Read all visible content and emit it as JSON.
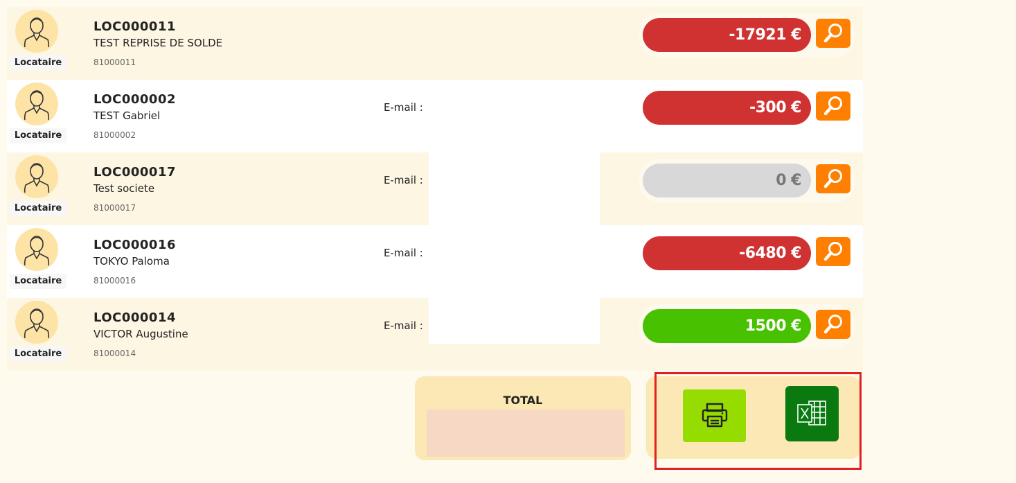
{
  "rows": [
    {
      "role": "Locataire",
      "code": "LOC000011",
      "name": "TEST REPRISE DE SOLDE",
      "ref": "81000011",
      "email_label": "",
      "balance": "-17921 €",
      "status": "neg"
    },
    {
      "role": "Locataire",
      "code": "LOC000002",
      "name": "TEST Gabriel",
      "ref": "81000002",
      "email_label": "E-mail :",
      "balance": "-300 €",
      "status": "neg"
    },
    {
      "role": "Locataire",
      "code": "LOC000017",
      "name": "Test societe",
      "ref": "81000017",
      "email_label": "E-mail :",
      "balance": "0 €",
      "status": "zero"
    },
    {
      "role": "Locataire",
      "code": "LOC000016",
      "name": "TOKYO Paloma",
      "ref": "81000016",
      "email_label": "E-mail :",
      "balance": "-6480 €",
      "status": "neg"
    },
    {
      "role": "Locataire",
      "code": "LOC000014",
      "name": "VICTOR Augustine",
      "ref": "81000014",
      "email_label": "E-mail :",
      "balance": "1500 €",
      "status": "pos"
    }
  ],
  "icons": {
    "avatar": "user-avatar-icon",
    "search": "magnifier-icon",
    "print": "printer-icon",
    "excel": "excel-icon"
  },
  "total": {
    "label": "TOTAL",
    "value": ""
  },
  "colors": {
    "negative": "#d03232",
    "zero": "#d8d8d8",
    "positive": "#48c200",
    "search_button": "#ff8000",
    "print_button": "#97dc00",
    "excel_button": "#0a7a10",
    "highlight": "#e02020"
  }
}
